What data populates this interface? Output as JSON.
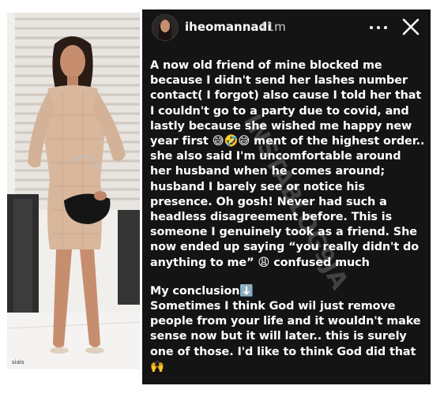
{
  "story": {
    "username": "iheomannadi",
    "time": "41m",
    "paragraph1": "A now old friend of mine blocked me because I didn't send her lashes number contact( I forgot) also cause I told her that I couldn't go to a party due to covid, and lastly because she wished me happy new year first",
    "emoji_laugh": "😅🤣😅",
    "paragraph1b": "ment of the highest order.. she also said I'm uncomfortable around her husband when he comes around; husband I barely see or notice his presence. Oh gosh! Never had such a headless disagreement before. This is someone I genuinely took as a friend. She now ended up saying “you really didn't do anything to me”",
    "emoji_tired": "😩",
    "paragraph1c": "confused much",
    "conclusion_heading": "My conclusion",
    "emoji_down": "⬇️",
    "paragraph2": "Sometimes I think God wil just remove people from your life and it wouldn't make sense now but it will later.. this is surely one of those. I'd like to think God did that",
    "emoji_hands": "🙌",
    "watermark_text": "INSTABLOG9JA"
  },
  "photo": {
    "caption": "sials"
  },
  "colors": {
    "story_bg": "#141414",
    "text": "#ffffff",
    "dress": "#d8b79c",
    "bag": "#151515"
  }
}
